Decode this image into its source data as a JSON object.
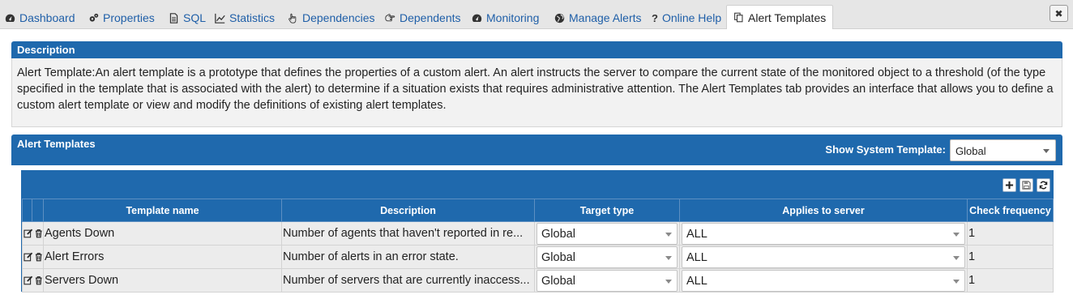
{
  "tabs": [
    {
      "label": "Dashboard",
      "icon": "dashboard-icon"
    },
    {
      "label": "Properties",
      "icon": "gears-icon"
    },
    {
      "label": "SQL",
      "icon": "document-icon"
    },
    {
      "label": "Statistics",
      "icon": "line-chart-icon"
    },
    {
      "label": "Dependencies",
      "icon": "hand-pointer-icon"
    },
    {
      "label": "Dependents",
      "icon": "hand-pointer-icon"
    },
    {
      "label": "Monitoring",
      "icon": "dashboard-icon"
    },
    {
      "label": "Manage Alerts",
      "icon": "globe-icon"
    },
    {
      "label": "Online Help",
      "icon": "question-icon"
    },
    {
      "label": "Alert Templates",
      "icon": "copy-icon",
      "active": true
    }
  ],
  "close_label": "✖",
  "description": {
    "header": "Description",
    "text": "Alert Template:An alert template is a prototype that defines the properties of a custom alert. An alert instructs the server to compare the current state of the monitored object to a threshold (of the type specified in the template that is associated with the alert) to determine if a situation exists that requires administrative attention. The Alert Templates tab provides an interface that allows you to define a custom alert template or view and modify the definitions of existing alert templates."
  },
  "alert_templates": {
    "header": "Alert Templates",
    "show_system_label": "Show System Template:",
    "show_system_value": "Global",
    "toolbar": [
      "add-icon",
      "save-icon",
      "refresh-icon"
    ],
    "columns": [
      "Template name",
      "Description",
      "Target type",
      "Applies to server",
      "Check frequency"
    ],
    "rows": [
      {
        "name": "Agents Down",
        "description": "Number of agents that haven't reported in re...",
        "target_type": "Global",
        "applies_to": "ALL",
        "frequency": "1"
      },
      {
        "name": "Alert Errors",
        "description": "Number of alerts in an error state.",
        "target_type": "Global",
        "applies_to": "ALL",
        "frequency": "1"
      },
      {
        "name": "Servers Down",
        "description": "Number of servers that are currently inaccess...",
        "target_type": "Global",
        "applies_to": "ALL",
        "frequency": "1"
      }
    ]
  },
  "colors": {
    "header_blue": "#1f69ad",
    "link_blue": "#1f5fa8",
    "row_bg": "#ececec"
  }
}
